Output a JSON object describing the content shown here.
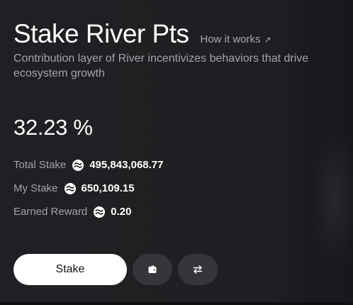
{
  "header": {
    "title": "Stake River Pts",
    "how_it_works_label": "How it works",
    "link_arrow": "↗"
  },
  "subtitle": "Contribution layer of River incentivizes behaviors that drive ecosystem growth",
  "apr": "32.23 %",
  "stats": {
    "total_stake": {
      "label": "Total Stake",
      "value": "495,843,068.77"
    },
    "my_stake": {
      "label": "My Stake",
      "value": "650,109.15"
    },
    "earned_reward": {
      "label": "Earned Reward",
      "value": "0.20"
    }
  },
  "actions": {
    "stake_label": "Stake",
    "wallet_icon": "wallet-icon",
    "swap_icon": "swap-arrows-icon"
  },
  "colors": {
    "background": "#1e1f22",
    "primary_button": "#ffffff",
    "secondary_button": "#35363a",
    "muted_text": "#a3a4a8"
  }
}
